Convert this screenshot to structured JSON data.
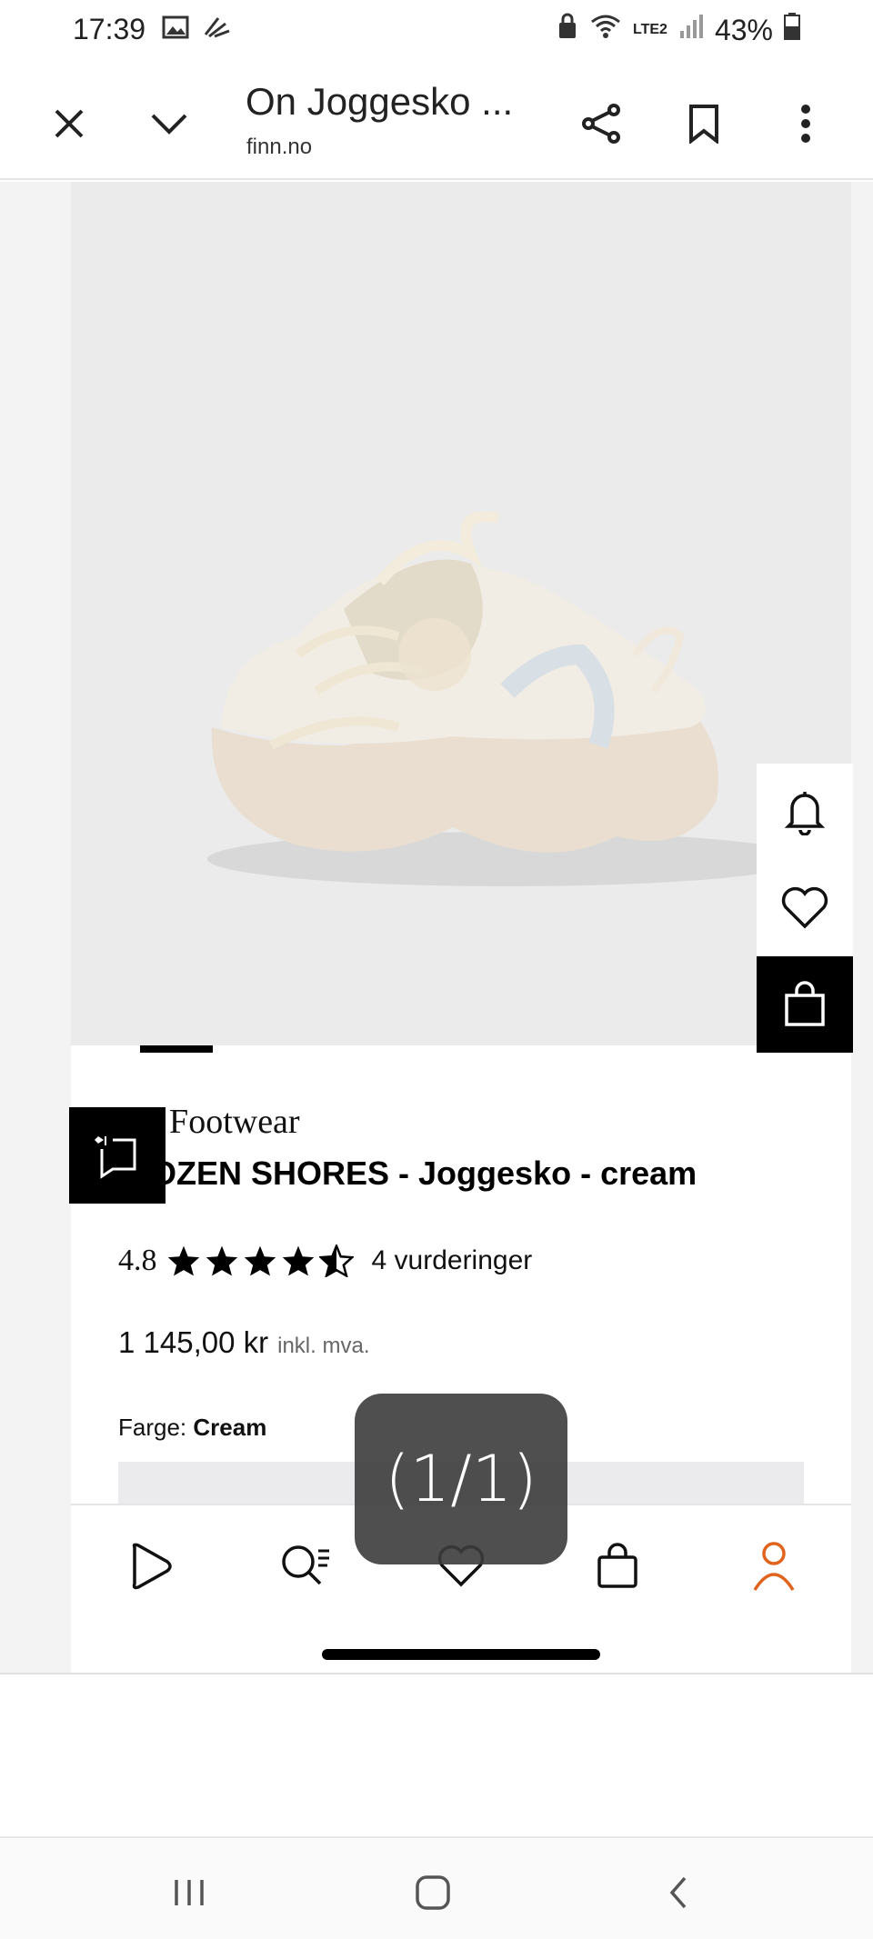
{
  "status_bar": {
    "time": "17:39",
    "battery": "43%",
    "network": "LTE2",
    "icons": [
      "image-icon",
      "nike-icon",
      "lock-icon",
      "wifi-icon",
      "signal-icon",
      "battery-icon"
    ]
  },
  "browser": {
    "title": "On Joggesko ...",
    "domain": "finn.no",
    "icons": [
      "close-icon",
      "chevron-down-icon",
      "share-icon",
      "bookmark-icon",
      "more-vert-icon"
    ]
  },
  "product": {
    "brand": "i Footwear",
    "name": "OZEN SHORES - Joggesko - cream",
    "rating": "4.8",
    "stars": 4.5,
    "reviews": "4 vurderinger",
    "price": "1 145,00 kr",
    "vat": "inkl. mva.",
    "color_label": "Farge:",
    "color_value": "Cream",
    "image_subject": "cream chunky sneaker"
  },
  "side_actions": [
    "bell-icon",
    "heart-icon",
    "bag-icon"
  ],
  "web_nav": [
    "play-icon",
    "search-list-icon",
    "heart-icon",
    "bag-icon",
    "profile-icon"
  ],
  "toast": {
    "text": "(1/1)"
  },
  "colors": {
    "accent_profile": "#e0641e",
    "image_bg": "#ebebeb",
    "black": "#000000"
  }
}
